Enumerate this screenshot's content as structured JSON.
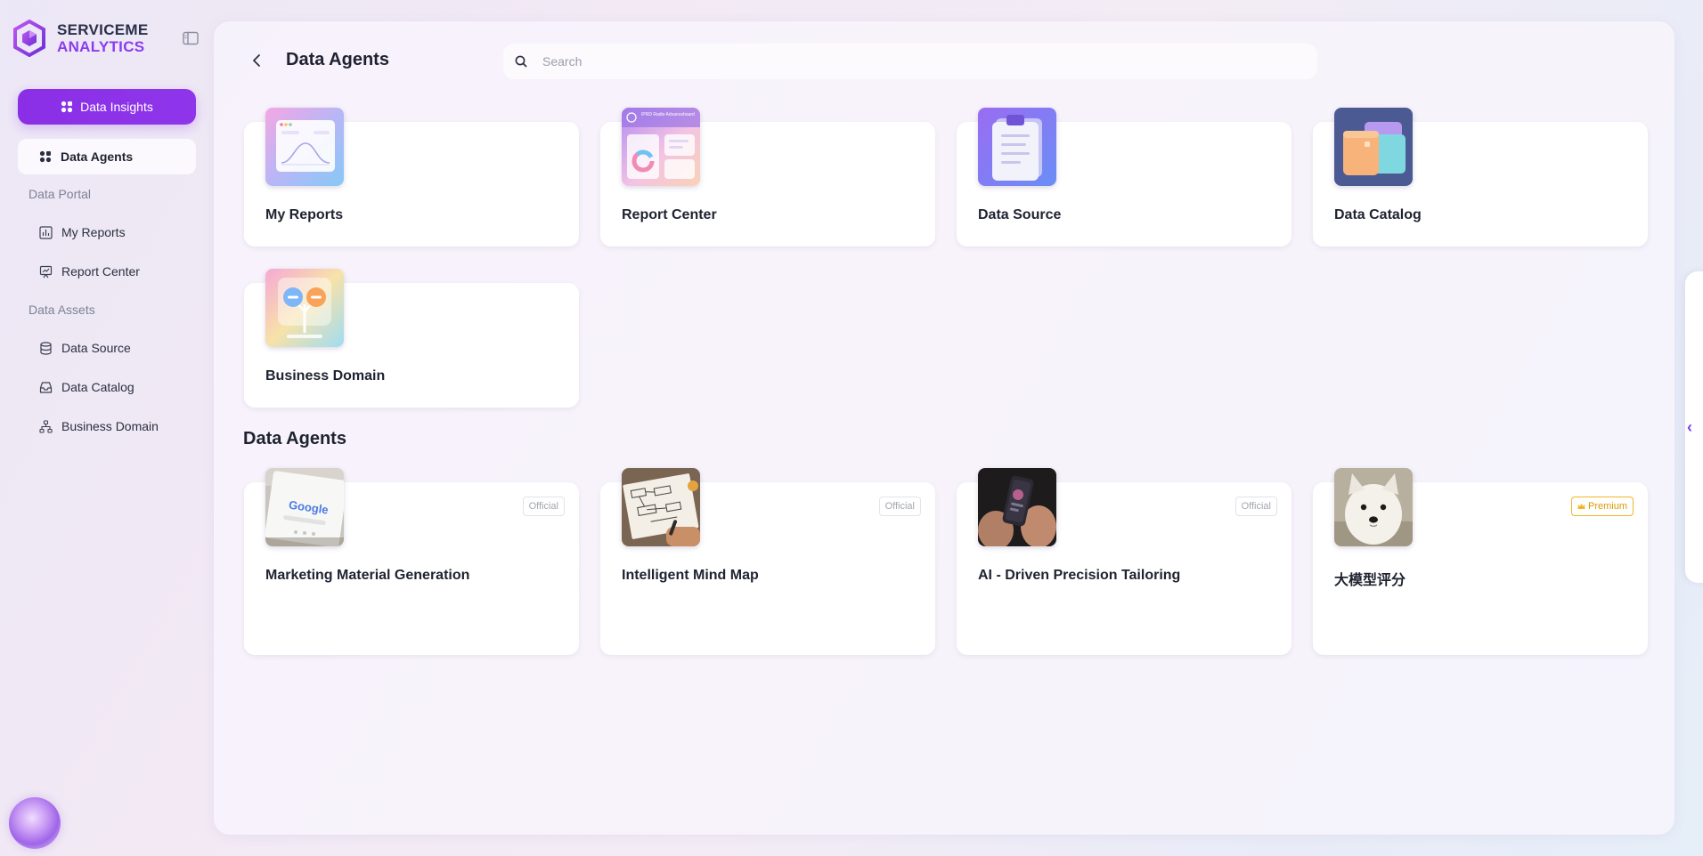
{
  "brand": {
    "line1": "SERVICEME",
    "line2": "ANALYTICS"
  },
  "sidebar": {
    "primary_button": "Data Insights",
    "active_item": "Data Agents",
    "sections": [
      {
        "title": "Data Portal",
        "items": [
          {
            "label": "My Reports",
            "icon": "chart-icon"
          },
          {
            "label": "Report Center",
            "icon": "presentation-icon"
          }
        ]
      },
      {
        "title": "Data Assets",
        "items": [
          {
            "label": "Data Source",
            "icon": "database-icon"
          },
          {
            "label": "Data Catalog",
            "icon": "inbox-icon"
          },
          {
            "label": "Business Domain",
            "icon": "hierarchy-icon"
          }
        ]
      }
    ]
  },
  "header": {
    "title": "Data Agents",
    "search_placeholder": "Search"
  },
  "modules": [
    {
      "title": "My Reports",
      "icon": "reports-thumbnail"
    },
    {
      "title": "Report Center",
      "icon": "report-center-thumbnail"
    },
    {
      "title": "Data Source",
      "icon": "clipboard-thumbnail"
    },
    {
      "title": "Data Catalog",
      "icon": "folder-thumbnail"
    },
    {
      "title": "Business Domain",
      "icon": "domain-thumbnail"
    }
  ],
  "agents_section_title": "Data Agents",
  "agents": [
    {
      "title": "Marketing Material Generation",
      "badge": "Official",
      "image": "google-tablet-photo"
    },
    {
      "title": "Intelligent Mind Map",
      "badge": "Official",
      "image": "mind-map-sketch-photo"
    },
    {
      "title": "AI - Driven Precision Tailoring",
      "badge": "Official",
      "image": "phone-in-hands-photo"
    },
    {
      "title": "大模型评分",
      "badge": "Premium",
      "image": "white-dog-photo"
    }
  ],
  "thumbnail_texts": {
    "report_center": "IPRD Radio Advanceboard",
    "google": "Google"
  },
  "colors": {
    "accent": "#8a2be2",
    "premium": "#f2b625"
  }
}
